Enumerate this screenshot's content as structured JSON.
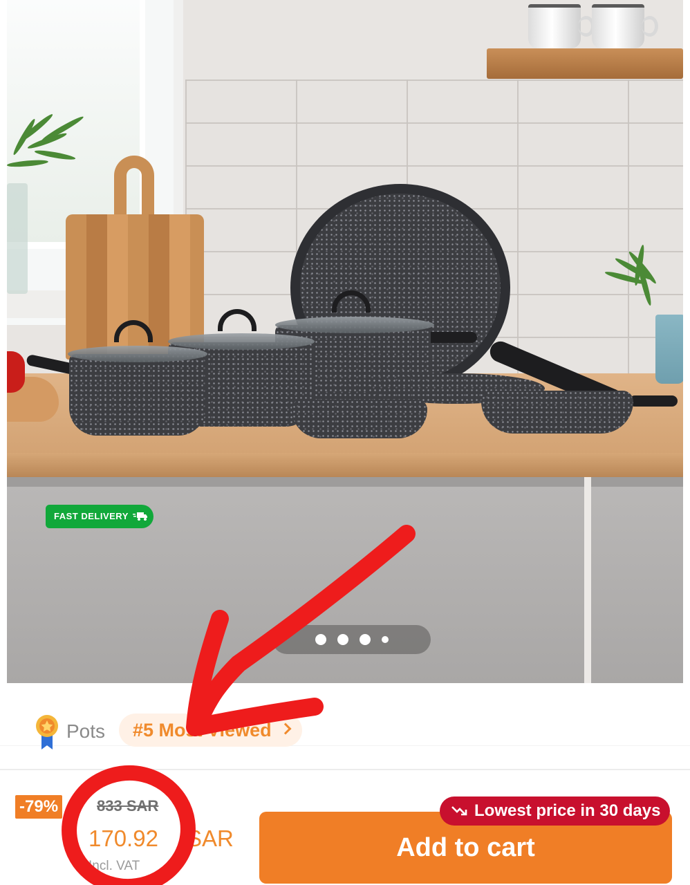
{
  "gallery": {
    "badge_label": "FAST DELIVERY",
    "slide_count": 4,
    "active_slide": 1
  },
  "ranking": {
    "category": "Pots",
    "rank_text": "#5 Most Viewed"
  },
  "pricing": {
    "discount": "-79%",
    "original_price": "833 SAR",
    "price": "170.92",
    "currency": "SAR",
    "vat_note": "Incl. VAT",
    "lowest_badge": "Lowest price in 30 days"
  },
  "actions": {
    "add_to_cart_label": "Add to cart"
  },
  "colors": {
    "accent": "#f07e26",
    "badge_green": "#11a83a",
    "badge_red": "#c8102e",
    "annotation": "#ee1c1c"
  },
  "icons": {
    "medal": "medal-icon",
    "truck": "truck-icon",
    "chevron": "chevron-right-icon",
    "trend": "trending-down-icon"
  }
}
